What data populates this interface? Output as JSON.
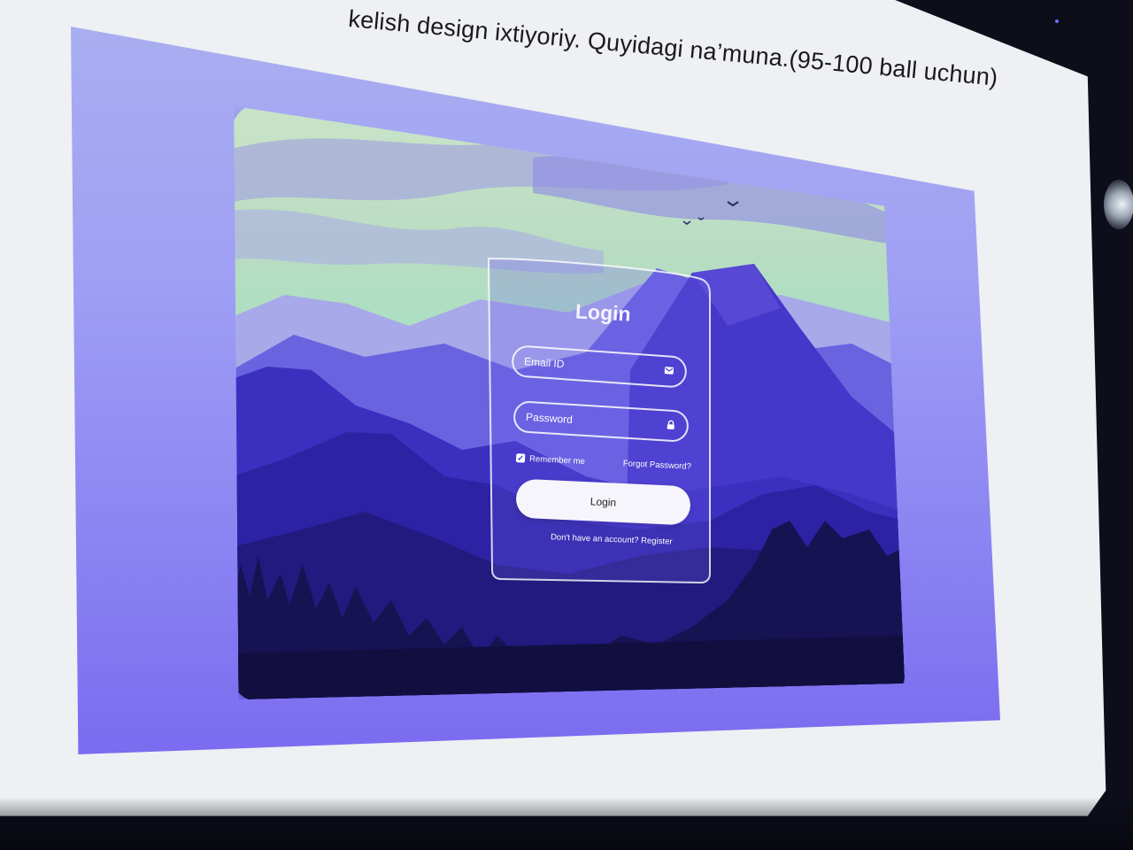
{
  "slide": {
    "caption": "kelish design ixtiyoriy. Quyidagi na’muna.(95-100 ball uchun)"
  },
  "login": {
    "title": "Login",
    "email_placeholder": "Email ID",
    "password_placeholder": "Password",
    "remember_label": "Remember me",
    "remember_checked": true,
    "forgot_label": "Forgot Password?",
    "submit_label": "Login",
    "register_prompt": "Don't have an account?",
    "register_link": "Register"
  },
  "icons": {
    "email": "mail-icon",
    "password": "lock-icon",
    "checkbox": "check-icon"
  },
  "colors": {
    "slide_bg": "#eef0f3",
    "frame_bg": "#9f9ff4",
    "accent_purple": "#4b3bd6",
    "button_bg": "#f6f5fb"
  }
}
